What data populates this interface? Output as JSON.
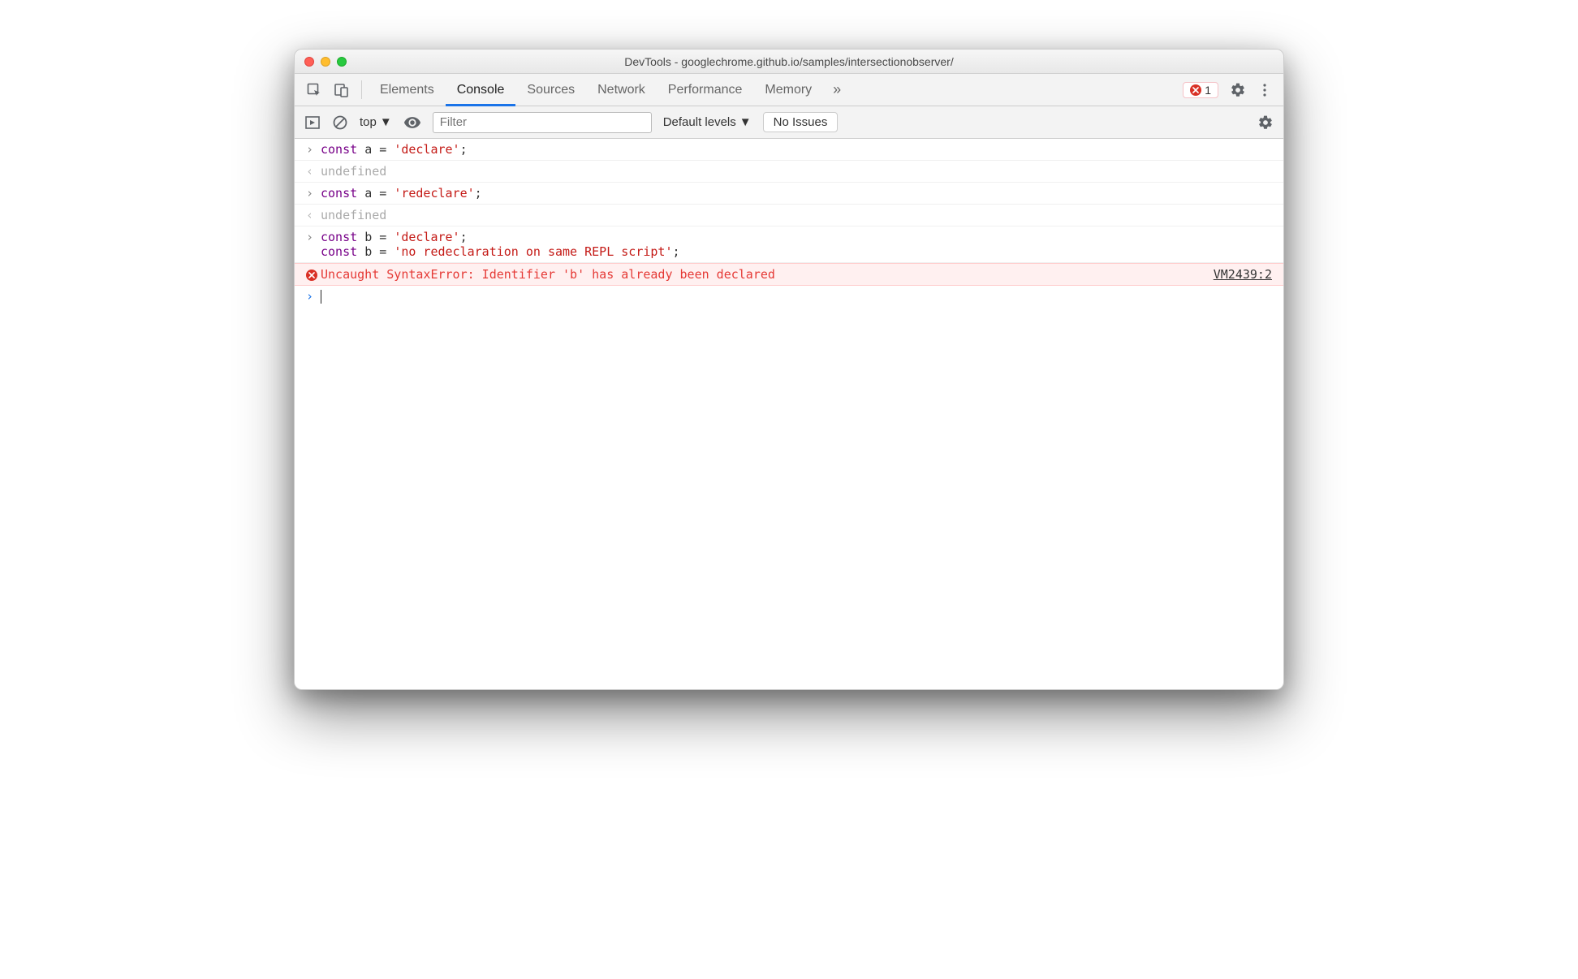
{
  "window": {
    "title": "DevTools - googlechrome.github.io/samples/intersectionobserver/"
  },
  "tabs": {
    "items": [
      "Elements",
      "Console",
      "Sources",
      "Network",
      "Performance",
      "Memory"
    ],
    "active_index": 1,
    "overflow_glyph": "»"
  },
  "error_badge": {
    "count": "1"
  },
  "toolbar": {
    "context": "top",
    "filter_placeholder": "Filter",
    "levels_label": "Default levels",
    "issues_label": "No Issues"
  },
  "console": {
    "entries": [
      {
        "type": "input",
        "tokens": [
          [
            "kw",
            "const"
          ],
          [
            "sp",
            " "
          ],
          [
            "id",
            "a"
          ],
          [
            "sp",
            " "
          ],
          [
            "op",
            "="
          ],
          [
            "sp",
            " "
          ],
          [
            "str",
            "'declare'"
          ],
          [
            "op",
            ";"
          ]
        ]
      },
      {
        "type": "result",
        "text": "undefined"
      },
      {
        "type": "input",
        "tokens": [
          [
            "kw",
            "const"
          ],
          [
            "sp",
            " "
          ],
          [
            "id",
            "a"
          ],
          [
            "sp",
            " "
          ],
          [
            "op",
            "="
          ],
          [
            "sp",
            " "
          ],
          [
            "str",
            "'redeclare'"
          ],
          [
            "op",
            ";"
          ]
        ]
      },
      {
        "type": "result",
        "text": "undefined"
      },
      {
        "type": "input",
        "lines": [
          [
            [
              "kw",
              "const"
            ],
            [
              "sp",
              " "
            ],
            [
              "id",
              "b"
            ],
            [
              "sp",
              " "
            ],
            [
              "op",
              "="
            ],
            [
              "sp",
              " "
            ],
            [
              "str",
              "'declare'"
            ],
            [
              "op",
              ";"
            ]
          ],
          [
            [
              "kw",
              "const"
            ],
            [
              "sp",
              " "
            ],
            [
              "id",
              "b"
            ],
            [
              "sp",
              " "
            ],
            [
              "op",
              "="
            ],
            [
              "sp",
              " "
            ],
            [
              "str",
              "'no redeclaration on same REPL script'"
            ],
            [
              "op",
              ";"
            ]
          ]
        ]
      },
      {
        "type": "error",
        "message": "Uncaught SyntaxError: Identifier 'b' has already been declared",
        "source": "VM2439:2"
      }
    ]
  }
}
